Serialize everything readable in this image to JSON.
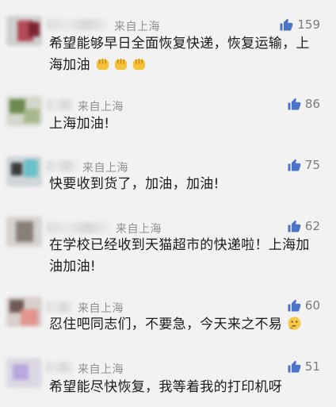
{
  "comments": [
    {
      "location": "来自上海",
      "likes": "159",
      "text": "希望能够早日全面恢复快递，恢复运输，上海加油",
      "emoji": [
        "fist-emoji",
        "fist-emoji",
        "fist-emoji"
      ]
    },
    {
      "location": "来自上海",
      "likes": "86",
      "text": "上海加油!"
    },
    {
      "location": "来自上海",
      "likes": "75",
      "text": "快要收到货了，加油，加油!"
    },
    {
      "location": "来自上海",
      "likes": "62",
      "text": "在学校已经收到天猫超市的快递啦！上海加油加油!"
    },
    {
      "location": "来自上海",
      "likes": "60",
      "text": "忍住吧同志们，不要急，今天来之不易",
      "emoji": [
        "thinking-face-emoji"
      ]
    },
    {
      "location": "来自上海",
      "likes": "51",
      "text": "希望能尽快恢复，我等着我的打印机呀"
    }
  ],
  "icons": {
    "like": "thumbs-up-icon"
  },
  "colors": {
    "like": "#4a73c9",
    "location": "#8f8f8f",
    "background": "#f2f2f2"
  }
}
